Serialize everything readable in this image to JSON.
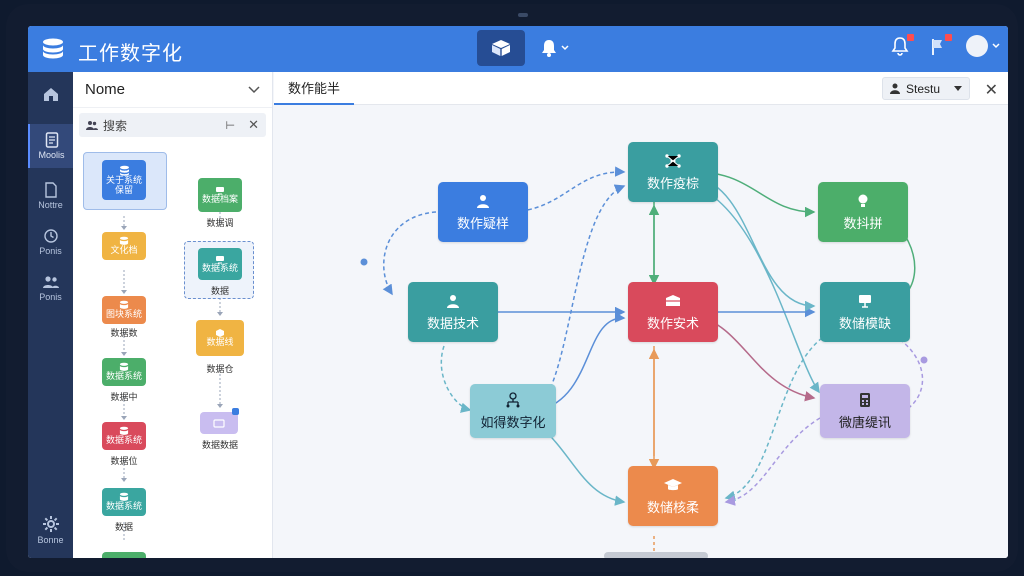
{
  "app": {
    "title": "工作数字化"
  },
  "rail": [
    {
      "label": ""
    },
    {
      "label": "Moolis"
    },
    {
      "label": "Nottre"
    },
    {
      "label": "Ponis"
    },
    {
      "label": "Ponis"
    },
    {
      "label": "Bonne"
    }
  ],
  "sidebar": {
    "title": "Nome",
    "search_label": "搜索",
    "tree": [
      {
        "label": "关于系统\n保留",
        "caption": "",
        "color": "#3b7de0"
      },
      {
        "label": "文化档",
        "caption": "",
        "color": "#f0b443"
      },
      {
        "label": "图块系统",
        "caption": "数据数",
        "color": "#ec8a4c"
      },
      {
        "label": "数据系统",
        "caption": "数据中",
        "color": "#4cae6a"
      },
      {
        "label": "数据系统",
        "caption": "数据位",
        "color": "#d94a5c"
      },
      {
        "label": "数据系统",
        "caption": "数据",
        "color": "#3aa6a0"
      },
      {
        "label": "数据档案",
        "caption": "数据调",
        "color": "#4cae6a"
      },
      {
        "label": "数据系统",
        "caption": "数据",
        "color": "#3aa6a0"
      },
      {
        "label": "数据线",
        "caption": "数据仓",
        "color": "#f0b443"
      },
      {
        "label": "",
        "caption": "数据数据",
        "color": "#a89ae0"
      }
    ]
  },
  "main": {
    "tab": "数作能半",
    "status_label": "Stestu"
  },
  "nodes": [
    {
      "id": "n1",
      "label": "数作疑样",
      "color": "#3b7de0"
    },
    {
      "id": "n2",
      "label": "数作疫棕",
      "color": "#3a9ea0"
    },
    {
      "id": "n3",
      "label": "数抖拼",
      "color": "#4cae6a"
    },
    {
      "id": "n4",
      "label": "数据技术",
      "color": "#3a9ea0"
    },
    {
      "id": "n5",
      "label": "数作安术",
      "color": "#d94a5c"
    },
    {
      "id": "n6",
      "label": "数储模缺",
      "color": "#3a9ea0"
    },
    {
      "id": "n7",
      "label": "如得数字化",
      "color": "#8ccbd6"
    },
    {
      "id": "n8",
      "label": "微唐缇讯",
      "color": "#c3b6e8"
    },
    {
      "id": "n9",
      "label": "数储核柔",
      "color": "#ec8a4c"
    }
  ],
  "colors": {
    "topbar": "#3b7de0",
    "rail": "#24365a",
    "canvas": "#f4f6fa"
  }
}
